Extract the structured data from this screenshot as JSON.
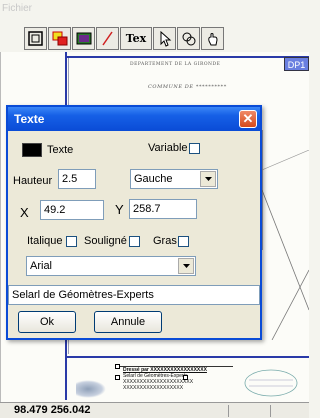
{
  "menubar": {
    "fichier": "Fichier"
  },
  "toolbar": {
    "tex_label": "Tex"
  },
  "background": {
    "departement": "DEPARTEMENT DE LA GIRONDE",
    "commune": "COMMUNE DE **********",
    "dp_badge": "DP1",
    "cartouche_title": "Dressé par XXXXXXXXXXXXXXXXX",
    "cartouche_line1": "Selarl de Géomètres-Experts",
    "cartouche_line2": "XXXXXXXXXXXXXXXXXXXXX",
    "cartouche_line3": "XXXXXXXXXXXXXXXXXX"
  },
  "status": {
    "coords": "98.479 256.042"
  },
  "dialog": {
    "title": "Texte",
    "texte_label": "Texte",
    "variable_label": "Variable",
    "hauteur_label": "Hauteur",
    "hauteur_value": "2.5",
    "alignment_value": "Gauche",
    "x_label": "X",
    "x_value": "49.2",
    "y_label": "Y",
    "y_value": "258.7",
    "italique_label": "Italique",
    "souligne_label": "Souligné",
    "gras_label": "Gras",
    "font_value": "Arial",
    "text_value": "Selarl de Géomètres-Experts",
    "ok_label": "Ok",
    "annule_label": "Annule"
  },
  "colors": {
    "title_bar": "#0a4bd6",
    "text_color": "#000000",
    "sheet_border": "#2a3aa8"
  }
}
